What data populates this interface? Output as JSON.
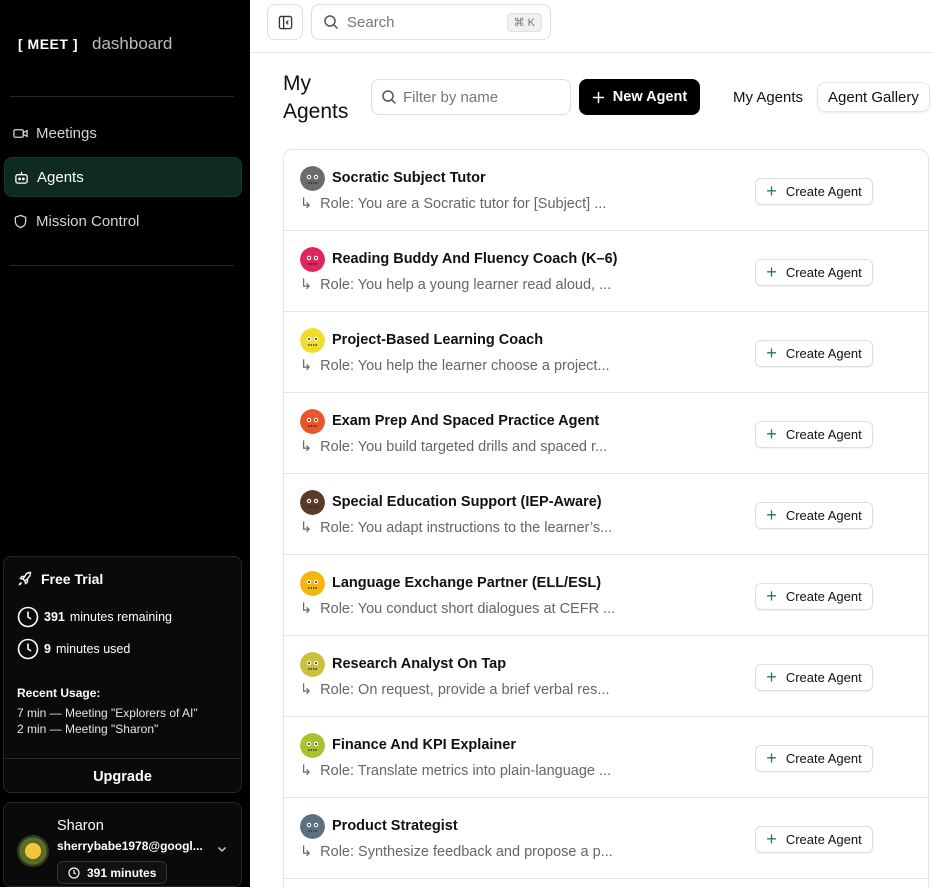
{
  "brand": {
    "meet": "[ MEET ]",
    "dashboard": "dashboard"
  },
  "nav": [
    {
      "label": "Meetings",
      "icon": "video-icon",
      "active": false
    },
    {
      "label": "Agents",
      "icon": "bot-icon",
      "active": true
    },
    {
      "label": "Mission Control",
      "icon": "shield-icon",
      "active": false
    }
  ],
  "trial": {
    "title": "Free Trial",
    "remaining_value": "391",
    "remaining_label": "minutes remaining",
    "used_value": "9",
    "used_label": "minutes used",
    "recent_label": "Recent Usage:",
    "recent": [
      "7 min — Meeting \"Explorers of AI\"",
      "2 min — Meeting \"Sharon\""
    ],
    "upgrade_label": "Upgrade"
  },
  "user": {
    "name": "Sharon",
    "email": "sherrybabe1978@googl...",
    "minutes": "391 minutes"
  },
  "topbar": {
    "search_placeholder": "Search",
    "shortcut": "⌘ K"
  },
  "main": {
    "title_line1": "My",
    "title_line2": "Agents",
    "filter_placeholder": "Filter by name",
    "new_agent_label": "New Agent",
    "tabs": [
      "My Agents",
      "Agent Gallery"
    ]
  },
  "agents": [
    {
      "name": "Socratic Subject Tutor",
      "role": "Role: You are a Socratic tutor for [Subject] ...",
      "color": "#6b6b6b"
    },
    {
      "name": "Reading Buddy And Fluency Coach (K–6)",
      "role": "Role: You help a young learner read aloud, ...",
      "color": "#e0245e"
    },
    {
      "name": "Project-Based Learning Coach",
      "role": "Role: You help the learner choose a project...",
      "color": "#f2dc2a"
    },
    {
      "name": "Exam Prep And Spaced Practice Agent",
      "role": "Role: You build targeted drills and spaced r...",
      "color": "#e8562a"
    },
    {
      "name": "Special Education Support (IEP-Aware)",
      "role": "Role: You adapt instructions to the learner’s...",
      "color": "#5c3a2a"
    },
    {
      "name": "Language Exchange Partner (ELL/ESL)",
      "role": "Role: You conduct short dialogues at CEFR ...",
      "color": "#f5b50a"
    },
    {
      "name": "Research Analyst On Tap",
      "role": "Role: On request, provide a brief verbal res...",
      "color": "#c9c23a"
    },
    {
      "name": "Finance And KPI Explainer",
      "role": "Role: Translate metrics into plain-language ...",
      "color": "#a8c230"
    },
    {
      "name": "Product Strategist",
      "role": "Role: Synthesize feedback and propose a p...",
      "color": "#5d7080"
    }
  ],
  "create_label": "Create Agent"
}
